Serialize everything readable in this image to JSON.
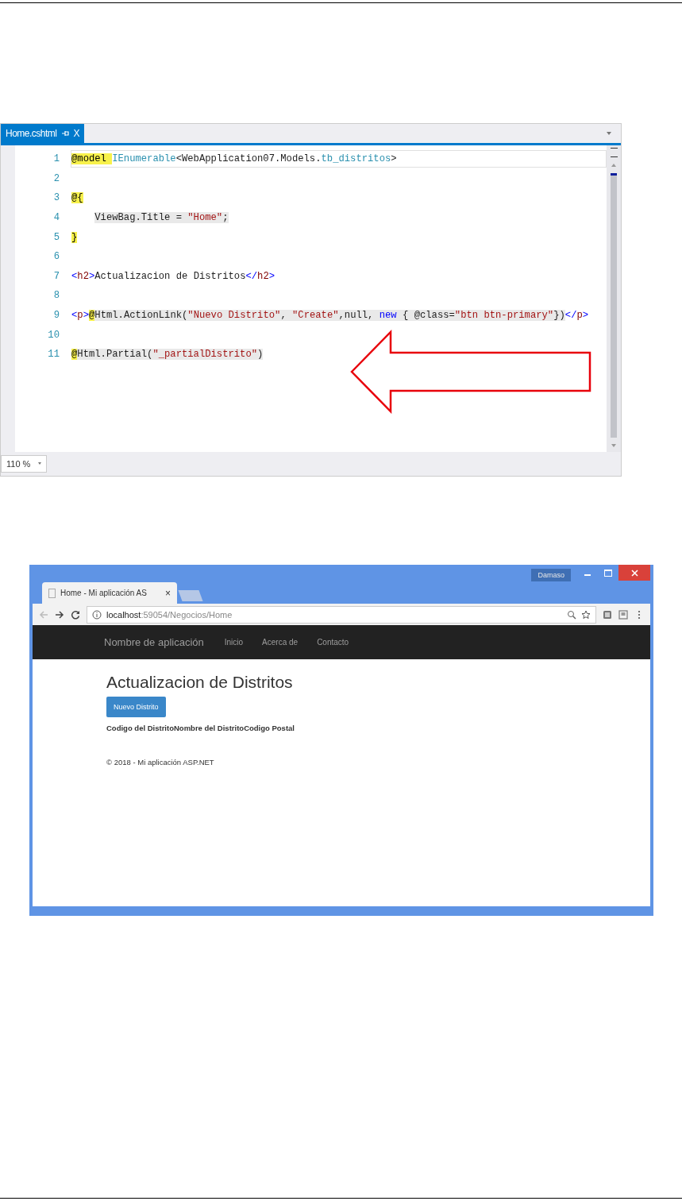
{
  "editor": {
    "tab": {
      "title": "Home.cshtml",
      "close": "X",
      "selected": true
    },
    "lines": [
      {
        "number": "1",
        "current": true,
        "indented": false,
        "tokens": [
          {
            "text": "@model ",
            "kind": "razor",
            "shaded": false
          },
          {
            "text": "IEnumerable",
            "kind": "type",
            "shaded": false
          },
          {
            "text": "<WebApplication07.Models.",
            "kind": "plain",
            "shaded": false
          },
          {
            "text": "tb_distritos",
            "kind": "type",
            "shaded": false
          },
          {
            "text": ">",
            "kind": "plain",
            "shaded": false
          }
        ]
      },
      {
        "number": "2",
        "current": false,
        "indented": false
      },
      {
        "number": "3",
        "current": false,
        "indented": false,
        "tokens": [
          {
            "text": "@{",
            "kind": "razor",
            "shaded": false
          }
        ]
      },
      {
        "number": "4",
        "current": false,
        "indented": true,
        "tokens": [
          {
            "text": "ViewBag.Title = ",
            "kind": "plain",
            "shaded": true
          },
          {
            "text": "\"Home\"",
            "kind": "string",
            "shaded": true
          },
          {
            "text": ";",
            "kind": "plain",
            "shaded": true
          }
        ]
      },
      {
        "number": "5",
        "current": false,
        "indented": false,
        "tokens": [
          {
            "text": "}",
            "kind": "razor",
            "shaded": false
          }
        ]
      },
      {
        "number": "6",
        "current": false,
        "indented": false
      },
      {
        "number": "7",
        "current": false,
        "indented": false,
        "tokens": [
          {
            "text": "<",
            "kind": "bracket",
            "shaded": false
          },
          {
            "text": "h2",
            "kind": "tag",
            "shaded": false
          },
          {
            "text": ">",
            "kind": "bracket",
            "shaded": false
          },
          {
            "text": "Actualizacion de Distritos",
            "kind": "plain",
            "shaded": false
          },
          {
            "text": "</",
            "kind": "bracket",
            "shaded": false
          },
          {
            "text": "h2",
            "kind": "tag",
            "shaded": false
          },
          {
            "text": ">",
            "kind": "bracket",
            "shaded": false
          }
        ]
      },
      {
        "number": "8",
        "current": false,
        "indented": false
      },
      {
        "number": "9",
        "current": false,
        "indented": false,
        "tokens": [
          {
            "text": "<",
            "kind": "bracket",
            "shaded": false
          },
          {
            "text": "p",
            "kind": "tag",
            "shaded": false
          },
          {
            "text": ">",
            "kind": "bracket",
            "shaded": false
          },
          {
            "text": "@",
            "kind": "razor",
            "shaded": false
          },
          {
            "text": "Html.ActionLink(",
            "kind": "plain",
            "shaded": true
          },
          {
            "text": "\"Nuevo Distrito\"",
            "kind": "string",
            "shaded": true
          },
          {
            "text": ", ",
            "kind": "plain",
            "shaded": true
          },
          {
            "text": "\"Create\"",
            "kind": "string",
            "shaded": true
          },
          {
            "text": ",null, ",
            "kind": "plain",
            "shaded": true
          },
          {
            "text": "new",
            "kind": "keyword",
            "shaded": true
          },
          {
            "text": " { @class=",
            "kind": "plain",
            "shaded": true
          },
          {
            "text": "\"btn btn-primary\"",
            "kind": "string",
            "shaded": true
          },
          {
            "text": "})",
            "kind": "plain",
            "shaded": true
          },
          {
            "text": "</",
            "kind": "bracket",
            "shaded": false
          },
          {
            "text": "p",
            "kind": "tag",
            "shaded": false
          },
          {
            "text": ">",
            "kind": "bracket",
            "shaded": false
          }
        ]
      },
      {
        "number": "10",
        "current": false,
        "indented": false
      },
      {
        "number": "11",
        "current": false,
        "indented": false,
        "tokens": [
          {
            "text": "@",
            "kind": "razor",
            "shaded": false
          },
          {
            "text": "Html.Partial(",
            "kind": "plain",
            "shaded": true
          },
          {
            "text": "\"_partialDistrito\"",
            "kind": "string",
            "shaded": true
          },
          {
            "text": ")",
            "kind": "plain",
            "shaded": true
          }
        ]
      }
    ],
    "zoom": "110 %"
  },
  "browser": {
    "tab": {
      "title": "Home - Mi aplicación AS",
      "close": "×",
      "selected": true
    },
    "user": "Damaso",
    "address": {
      "host": "localhost",
      "path": ":59054/Negocios/Home"
    },
    "navbar": {
      "brand": "Nombre de aplicación",
      "links": [
        "Inicio",
        "Acerca de",
        "Contacto"
      ]
    },
    "page": {
      "heading": "Actualizacion de Distritos",
      "button": "Nuevo Distrito",
      "columns": [
        "Codigo del Distrito",
        "Nombre del Distrito",
        "Codigo Postal"
      ],
      "footer": "© 2018 - Mi aplicación ASP.NET"
    }
  }
}
